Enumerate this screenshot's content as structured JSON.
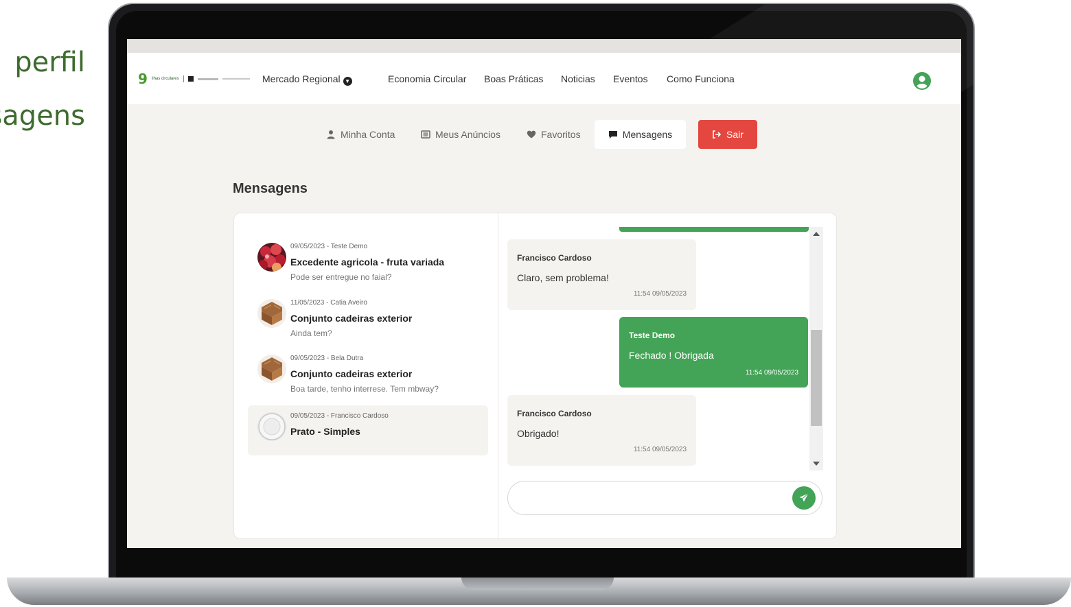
{
  "slide": {
    "line1": "perfil",
    "line2": "sagens"
  },
  "brand": {
    "logo_number": "9",
    "logo_words": "ilhas circulares",
    "accent_color": "#43a356",
    "danger_color": "#e4473f"
  },
  "navbar": {
    "items": [
      {
        "label": "Mercado Regional",
        "icon": "chevron-down-circle-icon"
      },
      {
        "label": "Economia Circular"
      },
      {
        "label": "Boas Práticas"
      },
      {
        "label": "Noticias"
      },
      {
        "label": "Eventos"
      },
      {
        "label": "Como Funciona"
      }
    ],
    "user_icon": "user-circle-icon"
  },
  "subnav": {
    "items": [
      {
        "label": "Minha Conta",
        "icon": "user-icon"
      },
      {
        "label": "Meus Anúncios",
        "icon": "list-icon"
      },
      {
        "label": "Favoritos",
        "icon": "heart-icon"
      },
      {
        "label": "Mensagens",
        "icon": "chat-icon",
        "active": true
      },
      {
        "label": "Sair",
        "icon": "logout-icon"
      }
    ]
  },
  "page": {
    "title": "Mensagens"
  },
  "conversations": [
    {
      "meta": "09/05/2023 - Teste Demo",
      "title": "Excedente agricola - fruta variada",
      "preview": "Pode ser entregue no faial?",
      "thumb": "fruit-thumbnail"
    },
    {
      "meta": "11/05/2023 - Catia Aveiro",
      "title": "Conjunto cadeiras exterior",
      "preview": "Ainda tem?",
      "thumb": "chair-thumbnail"
    },
    {
      "meta": "09/05/2023 - Bela Dutra",
      "title": "Conjunto cadeiras exterior",
      "preview": "Boa tarde, tenho interrese. Tem mbway?",
      "thumb": "chair-thumbnail"
    },
    {
      "meta": "09/05/2023 - Francisco Cardoso",
      "title": "Prato - Simples",
      "preview": "",
      "thumb": "plate-thumbnail",
      "selected": true
    }
  ],
  "chat": {
    "messages": [
      {
        "sender": "Francisco Cardoso",
        "text": "Claro, sem problema!",
        "time": "11:54 09/05/2023",
        "direction": "in"
      },
      {
        "sender": "Teste Demo",
        "text": "Fechado ! Obrigada",
        "time": "11:54 09/05/2023",
        "direction": "out"
      },
      {
        "sender": "Francisco Cardoso",
        "text": "Obrigado!",
        "time": "11:54 09/05/2023",
        "direction": "in"
      }
    ],
    "input_value": "",
    "send_icon": "send-icon"
  }
}
